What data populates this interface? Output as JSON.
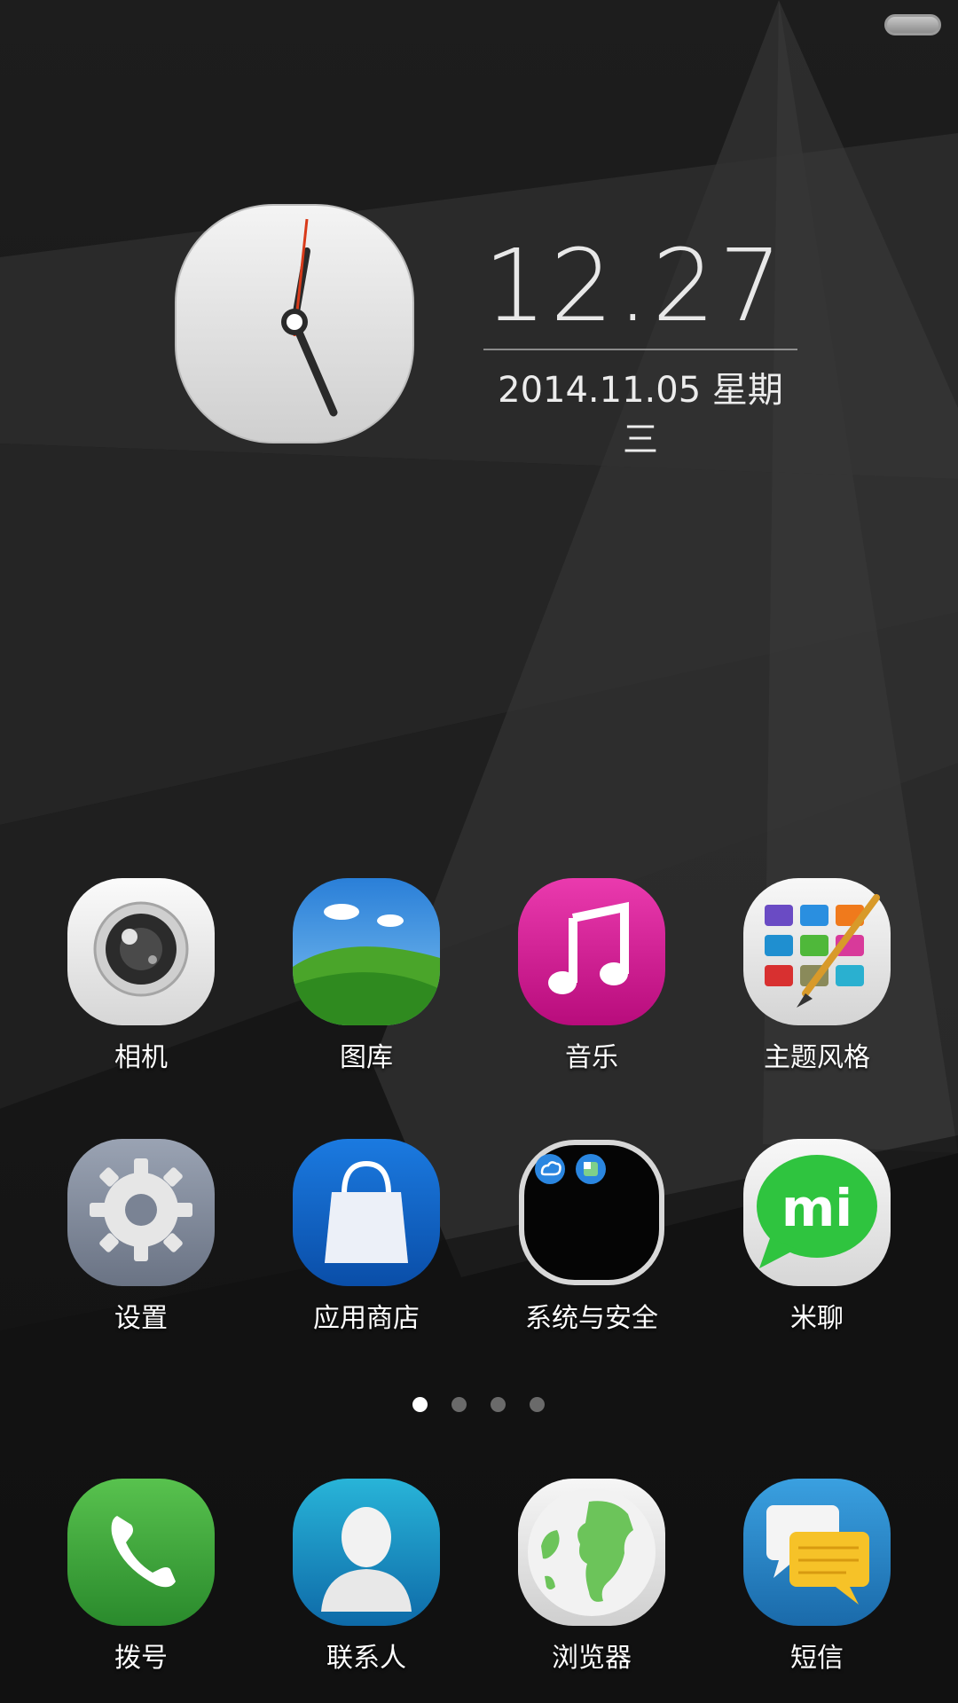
{
  "clock": {
    "time": "12.27",
    "date": "2014.11.05 星期三"
  },
  "apps": [
    {
      "label": "相机",
      "icon": "camera-icon"
    },
    {
      "label": "图库",
      "icon": "gallery-icon"
    },
    {
      "label": "音乐",
      "icon": "music-icon"
    },
    {
      "label": "主题风格",
      "icon": "themes-icon"
    },
    {
      "label": "设置",
      "icon": "settings-gear-icon"
    },
    {
      "label": "应用商店",
      "icon": "app-store-bag-icon"
    },
    {
      "label": "系统与安全",
      "icon": "folder-icon"
    },
    {
      "label": "米聊",
      "icon": "miliao-chat-icon"
    }
  ],
  "dock": [
    {
      "label": "拨号",
      "icon": "phone-icon"
    },
    {
      "label": "联系人",
      "icon": "contacts-icon"
    },
    {
      "label": "浏览器",
      "icon": "browser-globe-icon"
    },
    {
      "label": "短信",
      "icon": "messages-icon"
    }
  ],
  "page_indicator": {
    "pages": 4,
    "current": 1
  },
  "colors": {
    "background": "#1c1c1c",
    "text": "#ffffff",
    "music": "#d0148e",
    "phone": "#3aa03c",
    "store": "#0a5cc0",
    "miliao": "#2fc43f",
    "messages": "#2e86c9"
  }
}
